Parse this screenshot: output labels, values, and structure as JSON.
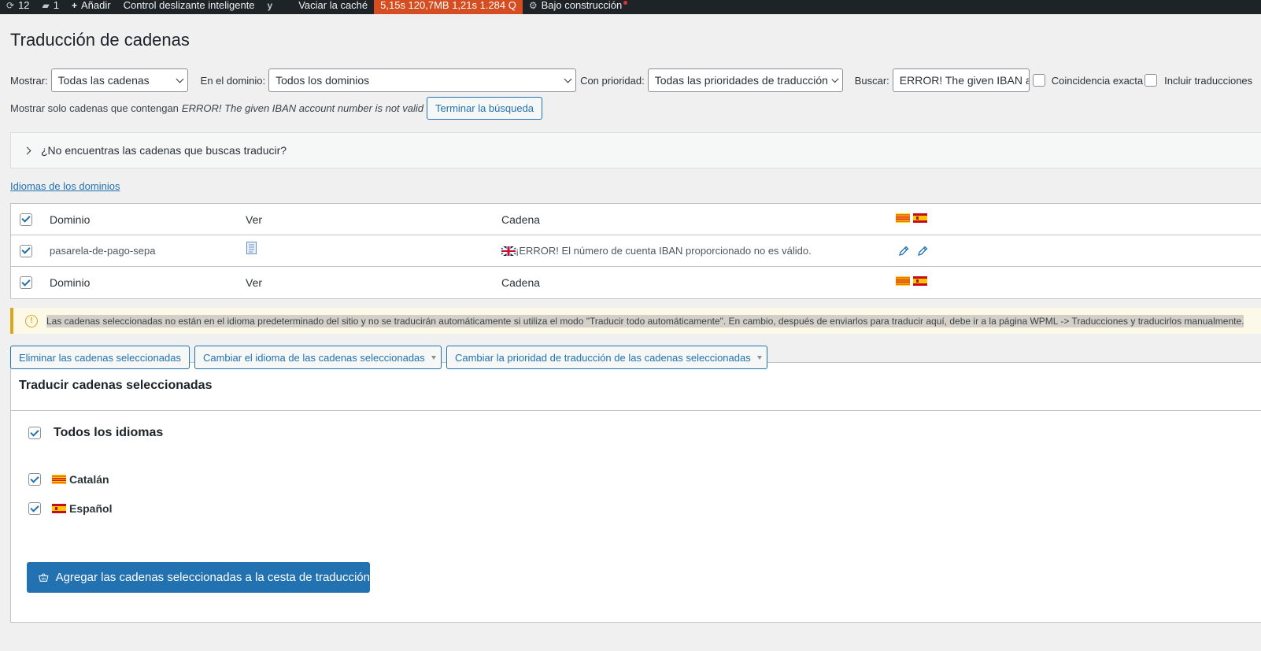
{
  "adminbar": {
    "updates_count": "12",
    "comments_count": "1",
    "add_new": "Añadir",
    "smart_slider": "Control deslizante inteligente",
    "clear_cache": "Vaciar la caché",
    "perf_stats": "5,15s  120,7MB  1,21s  1.284 Q",
    "maintenance": "Bajo construcción"
  },
  "page": {
    "title": "Traducción de cadenas"
  },
  "filters": {
    "show_label": "Mostrar:",
    "show_value": "Todas las cadenas",
    "domain_label": "En el dominio:",
    "domain_value": "Todos los dominios",
    "priority_label": "Con prioridad:",
    "priority_value": "Todas las prioridades de traducción",
    "search_label": "Buscar:",
    "search_value": "ERROR! The given IBAN ac",
    "exact_match": "Coincidencia exacta",
    "include_translations": "Incluir traducciones"
  },
  "search_note": {
    "prefix": "Mostrar solo cadenas que contengan",
    "term": "ERROR! The given IBAN account number is not valid",
    "end_button": "Terminar la búsqueda"
  },
  "accordion": {
    "label": "¿No encuentras las cadenas que buscas traducir?"
  },
  "domain_languages_link": "Idiomas de los dominios",
  "table": {
    "header": {
      "domain": "Dominio",
      "view": "Ver",
      "string": "Cadena"
    },
    "rows": [
      {
        "domain": "pasarela-de-pago-sepa",
        "string": "¡ERROR! El número de cuenta IBAN proporcionado no es válido."
      }
    ]
  },
  "notice": {
    "message": "Las cadenas seleccionadas no están en el idioma predeterminado del sitio y no se traducirán automáticamente si utiliza el modo \"Traducir todo automáticamente\". En cambio, después de enviarlos para traducir aquí, debe ir a la página WPML -> Traducciones y traducirlos manualmente."
  },
  "actions": {
    "delete": "Eliminar las cadenas seleccionadas",
    "change_language": "Cambiar el idioma de las cadenas seleccionadas",
    "change_priority": "Cambiar la prioridad de traducción de las cadenas seleccionadas"
  },
  "translate_panel": {
    "title": "Traducir cadenas seleccionadas",
    "all_languages": "Todos los idiomas",
    "languages": [
      "Catalán",
      "Español"
    ],
    "submit": "Agregar las cadenas seleccionadas a la cesta de traducción"
  },
  "colors": {
    "accent": "#2271b1",
    "adminbar": "#1d2327",
    "perf_bg": "#d54e21",
    "notice_border": "#dba617"
  }
}
